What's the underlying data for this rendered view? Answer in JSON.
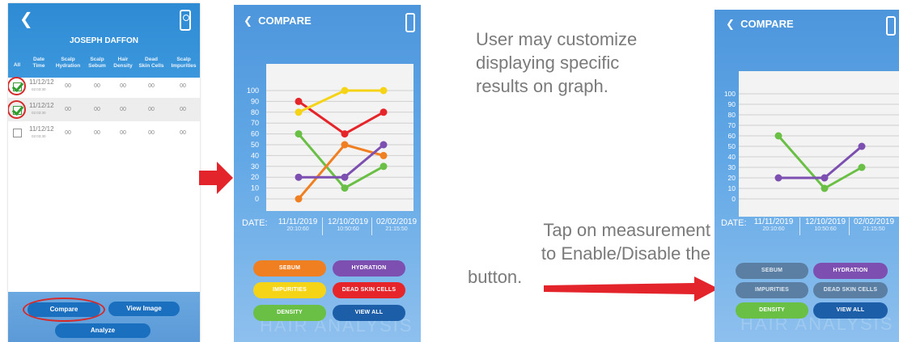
{
  "screen1": {
    "back_icon": "chevron-left-icon",
    "qr_icon": "qr-scan-icon",
    "name": "JOSEPH DAFFON",
    "columns": [
      {
        "l1": "All",
        "l2": ""
      },
      {
        "l1": "Date",
        "l2": "Time"
      },
      {
        "l1": "Scalp",
        "l2": "Hydration"
      },
      {
        "l1": "Scalp",
        "l2": "Sebum"
      },
      {
        "l1": "Hair",
        "l2": "Density"
      },
      {
        "l1": "Dead",
        "l2": "Skin Cells"
      },
      {
        "l1": "Scalp",
        "l2": "Impurities"
      }
    ],
    "rows": [
      {
        "date": "11/12/12",
        "time": "02:03:30",
        "checked": true,
        "values": [
          "00",
          "00",
          "00",
          "00",
          "00"
        ]
      },
      {
        "date": "11/12/12",
        "time": "02:03:30",
        "checked": true,
        "values": [
          "00",
          "00",
          "00",
          "00",
          "00"
        ]
      },
      {
        "date": "11/12/12",
        "time": "02:03:30",
        "checked": false,
        "values": [
          "00",
          "00",
          "00",
          "00",
          "00"
        ]
      }
    ],
    "buttons": {
      "compare": "Compare",
      "view_image": "View Image",
      "analyze": "Analyze"
    },
    "highlight_color": "#d62a2a"
  },
  "screen2": {
    "title": "COMPARE",
    "date_label": "DATE:",
    "dates": [
      {
        "date": "11/11/2019",
        "time": "20:10:60"
      },
      {
        "date": "12/10/2019",
        "time": "10:50:60"
      },
      {
        "date": "02/02/2019",
        "time": "21:15:50"
      }
    ],
    "buttons": [
      {
        "label": "SEBUM",
        "color": "#f07f22"
      },
      {
        "label": "HYDRATION",
        "color": "#7c4fb0"
      },
      {
        "label": "IMPURITIES",
        "color": "#f5d417"
      },
      {
        "label": "DEAD SKIN CELLS",
        "color": "#e6252b"
      },
      {
        "label": "DENSITY",
        "color": "#6abf45"
      },
      {
        "label": "VIEW ALL",
        "color": "#1d5ea8"
      }
    ],
    "watermark": "HAIR ANALYSIS"
  },
  "screen3": {
    "title": "COMPARE",
    "date_label": "DATE:",
    "dates": [
      {
        "date": "11/11/2019",
        "time": "20:10:60"
      },
      {
        "date": "12/10/2019",
        "time": "10:50:60"
      },
      {
        "date": "02/02/2019",
        "time": "21:15:50"
      }
    ],
    "buttons": [
      {
        "label": "SEBUM",
        "color": "#5a7fa3",
        "enabled": false
      },
      {
        "label": "HYDRATION",
        "color": "#7c4fb0",
        "enabled": true
      },
      {
        "label": "IMPURITIES",
        "color": "#5a7fa3",
        "enabled": false
      },
      {
        "label": "DEAD SKIN CELLS",
        "color": "#5a7fa3",
        "enabled": false
      },
      {
        "label": "DENSITY",
        "color": "#6abf45",
        "enabled": true
      },
      {
        "label": "VIEW ALL",
        "color": "#1d5ea8",
        "enabled": true
      }
    ],
    "watermark": "HAIR ANALYSIS"
  },
  "notes": {
    "customize": [
      "User may customize",
      "displaying specific",
      "results on graph."
    ],
    "tap": [
      "Tap on measurement",
      "to Enable/Disable the",
      "button."
    ]
  },
  "chart_data": [
    {
      "type": "line",
      "x": [
        "11/11/2019",
        "12/10/2019",
        "02/02/2019"
      ],
      "ylim": [
        0,
        100
      ],
      "yticks": [
        0,
        10,
        20,
        30,
        40,
        50,
        60,
        70,
        80,
        90,
        100
      ],
      "grid": true,
      "series": [
        {
          "name": "DEAD SKIN CELLS",
          "color": "#e6252b",
          "values": [
            90,
            60,
            80
          ]
        },
        {
          "name": "IMPURITIES",
          "color": "#f5d417",
          "values": [
            80,
            100,
            100
          ]
        },
        {
          "name": "DENSITY",
          "color": "#6abf45",
          "values": [
            60,
            10,
            30
          ]
        },
        {
          "name": "SEBUM",
          "color": "#f07f22",
          "values": [
            0,
            50,
            40
          ]
        },
        {
          "name": "HYDRATION",
          "color": "#7c4fb0",
          "values": [
            20,
            20,
            50
          ]
        }
      ]
    },
    {
      "type": "line",
      "x": [
        "11/11/2019",
        "12/10/2019",
        "02/02/2019"
      ],
      "ylim": [
        0,
        100
      ],
      "yticks": [
        0,
        10,
        20,
        30,
        40,
        50,
        60,
        70,
        80,
        90,
        100
      ],
      "grid": true,
      "series": [
        {
          "name": "DENSITY",
          "color": "#6abf45",
          "values": [
            60,
            10,
            30
          ]
        },
        {
          "name": "HYDRATION",
          "color": "#7c4fb0",
          "values": [
            20,
            20,
            50
          ]
        }
      ]
    }
  ]
}
